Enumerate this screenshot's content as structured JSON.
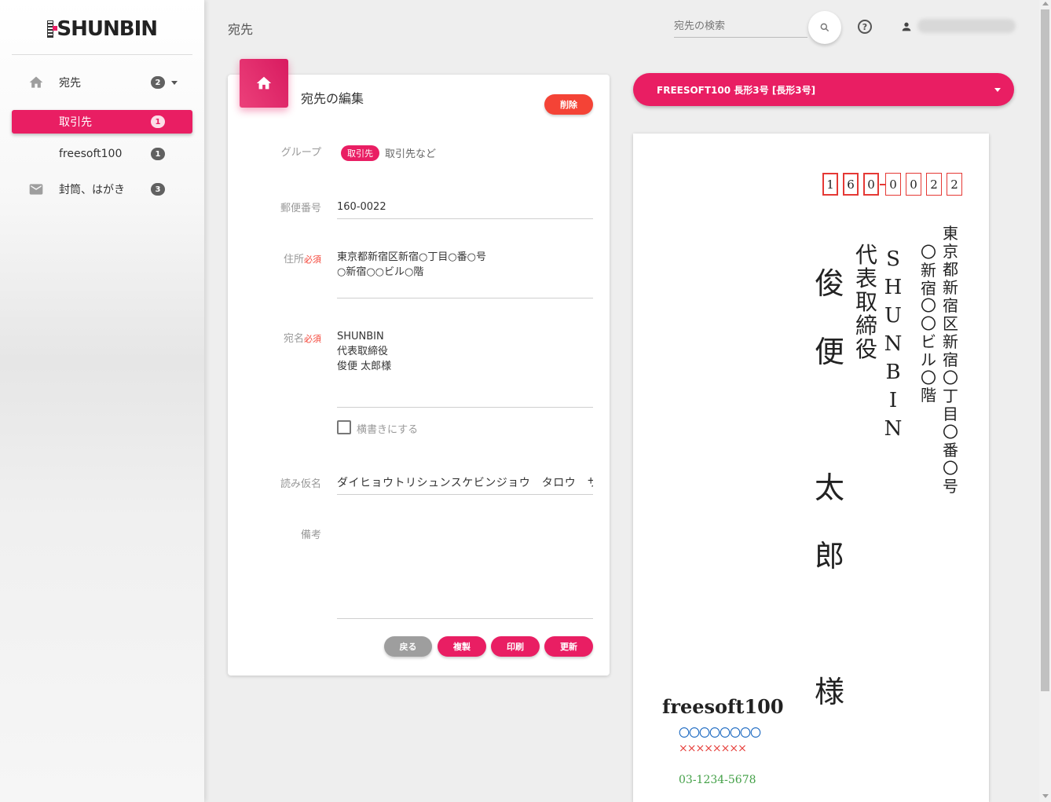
{
  "app": {
    "logo": "SHUNBIN"
  },
  "sidebar": {
    "items": [
      {
        "label": "宛先",
        "count": "2",
        "icon": "home-icon"
      },
      {
        "label": "取引先",
        "count": "1"
      },
      {
        "label": "freesoft100",
        "count": "1"
      },
      {
        "label": "封筒、はがき",
        "count": "3",
        "icon": "mail-icon"
      }
    ]
  },
  "header": {
    "title": "宛先",
    "search_placeholder": "宛先の検索",
    "help": "?"
  },
  "form": {
    "title": "宛先の編集",
    "delete_label": "削除",
    "required_mark": "必須",
    "group": {
      "label": "グループ",
      "chip": "取引先",
      "desc": "取引先など"
    },
    "postal": {
      "label": "郵便番号",
      "value": "160-0022"
    },
    "address": {
      "label": "住所",
      "line1": "東京都新宿区新宿○丁目○番○号",
      "line2": "○新宿○○ビル○階"
    },
    "name": {
      "label": "宛名",
      "line1": "SHUNBIN",
      "line2": "代表取締役",
      "line3": "俊便 太郎様"
    },
    "horizontal": {
      "label": "横書きにする",
      "checked": false
    },
    "kana": {
      "label": "読み仮名",
      "value": "ダイヒョウトリシュンスケビンジョウ　タロウ　サマ"
    },
    "note": {
      "label": "備考",
      "value": ""
    },
    "buttons": {
      "back": "戻る",
      "copy": "複製",
      "print": "印刷",
      "update": "更新"
    }
  },
  "preview": {
    "envelope_select": "FREESOFT100 長形3号 [長形3号]",
    "zip_digits": [
      "1",
      "6",
      "0",
      "0",
      "0",
      "2",
      "2"
    ],
    "address_col1": "東京都新宿区新宿〇丁目〇番〇号",
    "address_col2": "〇新宿〇〇ビル〇階",
    "company": "SHUNBIN",
    "title": "代表取締役",
    "recipient": "俊便 太郎 様",
    "sender": {
      "name": "freesoft100",
      "line1": "〇〇〇〇〇〇〇〇",
      "line2": "××××××××",
      "tel": "03-1234-5678"
    }
  },
  "colors": {
    "accent": "#e91e63",
    "danger": "#f44336",
    "muted_button": "#9e9e9e"
  }
}
